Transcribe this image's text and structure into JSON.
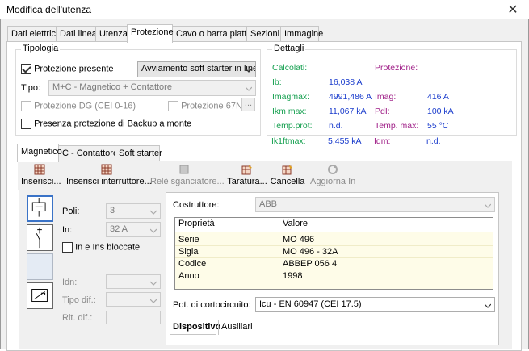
{
  "window": {
    "title": "Modifica dell'utenza",
    "close": "✕"
  },
  "tabs": [
    "Dati elettrici",
    "Dati linea",
    "Utenza",
    "Protezione",
    "Cavo o barra piatta",
    "Sezioni",
    "Immagine"
  ],
  "active_tab": "Protezione",
  "tipologia": {
    "group_title": "Tipologia",
    "protezione_presente": {
      "label": "Protezione presente",
      "checked": true
    },
    "avviamento": "Avviamento soft starter in linea",
    "tipo_label": "Tipo:",
    "tipo_value": "M+C - Magnetico + Contattore",
    "protezione_dg": "Protezione DG (CEI 0-16)",
    "protezione_67n": "Protezione 67N",
    "dots": "...",
    "backup": "Presenza protezione di Backup a monte"
  },
  "dettagli": {
    "group_title": "Dettagli",
    "calcolati_label": "Calcolati:",
    "protezione_label": "Protezione:",
    "rows_left": [
      {
        "label": "Ib:",
        "value": "16,038 A"
      },
      {
        "label": "Imagmax:",
        "value": "4991,486 A"
      },
      {
        "label": "Ikm max:",
        "value": "11,067 kA"
      },
      {
        "label": "Temp.prot:",
        "value": "n.d."
      },
      {
        "label": "Ik1ftmax:",
        "value": "5,455 kA"
      }
    ],
    "rows_right": [
      {
        "label": "Imag:",
        "value": "416 A"
      },
      {
        "label": "PdI:",
        "value": "100 kA"
      },
      {
        "label": "Temp. max:",
        "value": "55 °C"
      },
      {
        "label": "Idm:",
        "value": "n.d."
      }
    ]
  },
  "subtabs": [
    "Magnetico",
    "C - Contattore",
    "Soft starter"
  ],
  "toolbar": {
    "inserisci": "Inserisci...",
    "inserisci_interruttore": "Inserisci interruttore...",
    "rele": "Relè sganciatore...",
    "taratura": "Taratura...",
    "cancella": "Cancella",
    "aggiorna": "Aggiorna In"
  },
  "magnetico": {
    "poli_label": "Poli:",
    "poli_value": "3",
    "in_label": "In:",
    "in_value": "32 A",
    "in_ins_bloccate": "In e Ins bloccate",
    "idn_label": "Idn:",
    "tipo_dif_label": "Tipo dif.:",
    "rit_dif_label": "Rit. dif.:"
  },
  "dispositivo": {
    "costruttore_label": "Costruttore:",
    "costruttore_value": "ABB",
    "grid_headers": [
      "Proprietà",
      "Valore"
    ],
    "rows": [
      {
        "prop": "Serie",
        "val": "MO 496"
      },
      {
        "prop": "Sigla",
        "val": "MO 496 - 32A"
      },
      {
        "prop": "Codice",
        "val": "ABBEP 056 4"
      },
      {
        "prop": "Anno",
        "val": "1998"
      }
    ],
    "pot_label": "Pot. di cortocircuito:",
    "pot_value": "Icu - EN 60947 (CEI 17.5)",
    "bottom_tabs": [
      "Dispositivo",
      "Ausiliari"
    ]
  }
}
